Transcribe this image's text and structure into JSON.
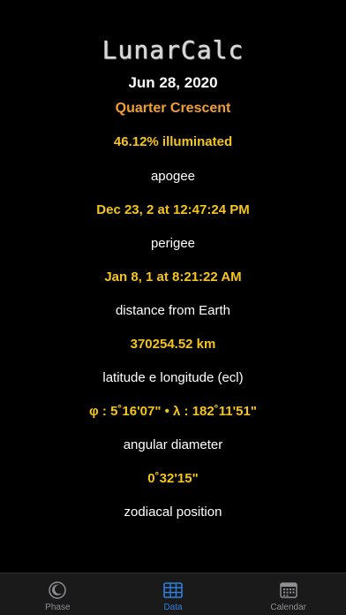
{
  "app": {
    "title": "LunarCalc"
  },
  "moon": {
    "date": "Jun 28, 2020",
    "phase_name": "Quarter Crescent",
    "illumination": "46.12% illuminated"
  },
  "rows": [
    {
      "label": "apogee",
      "value": "Dec 23, 2 at 12:47:24 PM"
    },
    {
      "label": "perigee",
      "value": "Jan 8, 1 at 8:21:22 AM"
    },
    {
      "label": "distance from Earth",
      "value": "370254.52 km"
    },
    {
      "label": "latitude e longitude (ecl)",
      "value": "φ : 5˚16'07\" • λ : 182˚11'51\""
    },
    {
      "label": "angular diameter",
      "value": "0˚32'15\""
    },
    {
      "label": "zodiacal position",
      "value": ""
    }
  ],
  "tabbar": {
    "tabs": [
      {
        "label": "Phase",
        "icon": "moon-icon"
      },
      {
        "label": "Data",
        "icon": "table-icon",
        "active": true
      },
      {
        "label": "Calendar",
        "icon": "calendar-icon"
      }
    ]
  },
  "colors": {
    "background": "#000000",
    "phase": "#f0a030",
    "value": "#f5c518",
    "active_tab": "#2f7fe0",
    "inactive_tab": "#8e8e93"
  }
}
